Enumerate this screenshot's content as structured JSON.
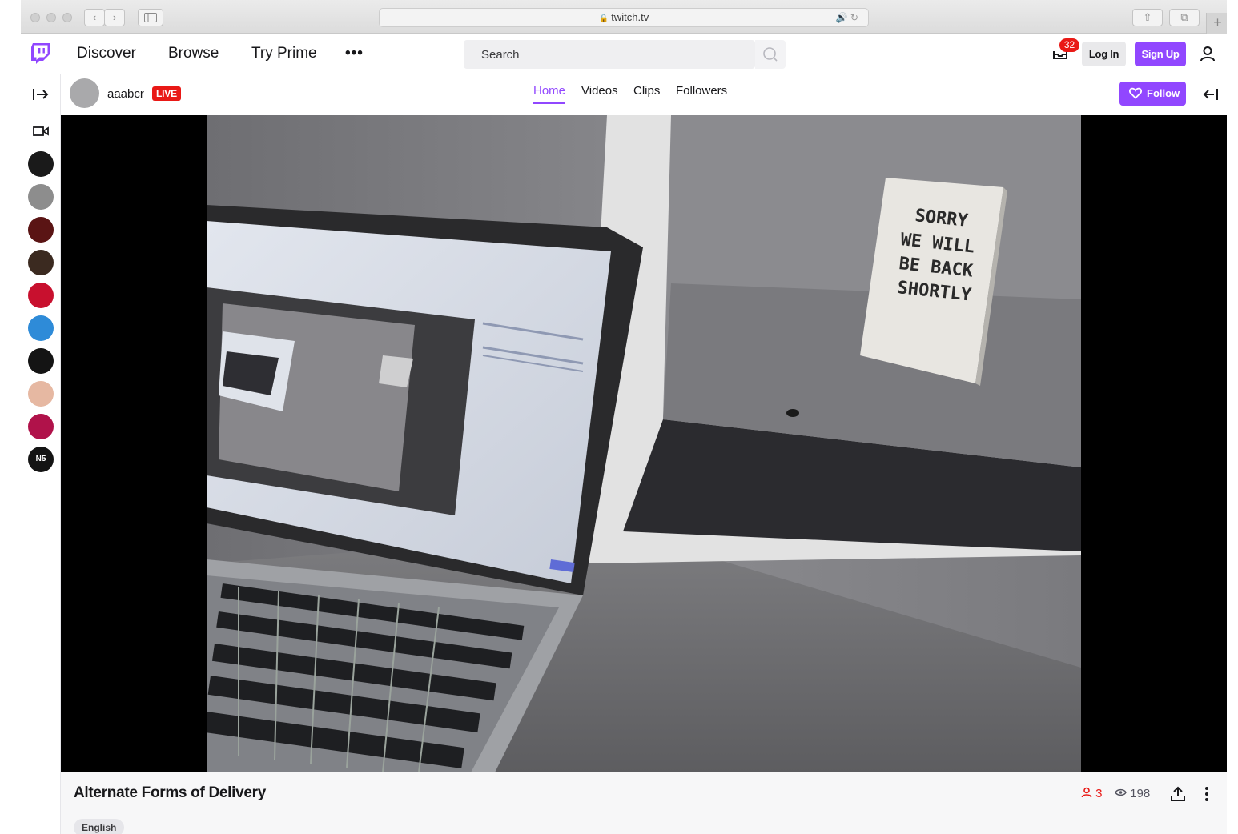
{
  "browser": {
    "url": "twitch.tv",
    "icons": [
      "back-icon",
      "forward-icon",
      "sidebar-icon",
      "lock-icon",
      "audio-icon",
      "reload-icon",
      "share-icon",
      "tabs-icon",
      "new-tab-icon"
    ]
  },
  "nav": {
    "links": [
      "Discover",
      "Browse",
      "Try Prime"
    ],
    "more": "•••",
    "search_placeholder": "Search",
    "notification_count": "32",
    "login_label": "Log In",
    "signup_label": "Sign Up"
  },
  "channel": {
    "name": "aaabcr",
    "live_label": "LIVE",
    "tabs": [
      "Home",
      "Videos",
      "Clips",
      "Followers"
    ],
    "active_tab": "Home",
    "follow_label": "Follow"
  },
  "sidebar": {
    "avatars": [
      {
        "name": "avatar-1",
        "color": "#1a1a1a"
      },
      {
        "name": "avatar-2",
        "color": "#8d8d8d"
      },
      {
        "name": "avatar-3",
        "color": "#5a1414"
      },
      {
        "name": "avatar-4",
        "color": "#3b2a20"
      },
      {
        "name": "avatar-5",
        "color": "#c8102e"
      },
      {
        "name": "avatar-6",
        "color": "#2e8bd8"
      },
      {
        "name": "avatar-7",
        "color": "#141414"
      },
      {
        "name": "avatar-8",
        "color": "#e6b8a2"
      },
      {
        "name": "avatar-9",
        "color": "#b0124a"
      },
      {
        "name": "avatar-10",
        "color": "#141414",
        "text": "N5"
      }
    ]
  },
  "stream": {
    "title": "Alternate Forms of Delivery",
    "language": "English",
    "viewer_count": "3",
    "view_count": "198",
    "sign_text": [
      "SORRY",
      "WE WILL",
      "BE BACK",
      "SHORTLY"
    ]
  },
  "colors": {
    "accent": "#9147ff",
    "live": "#e91916",
    "text": "#18181b"
  }
}
